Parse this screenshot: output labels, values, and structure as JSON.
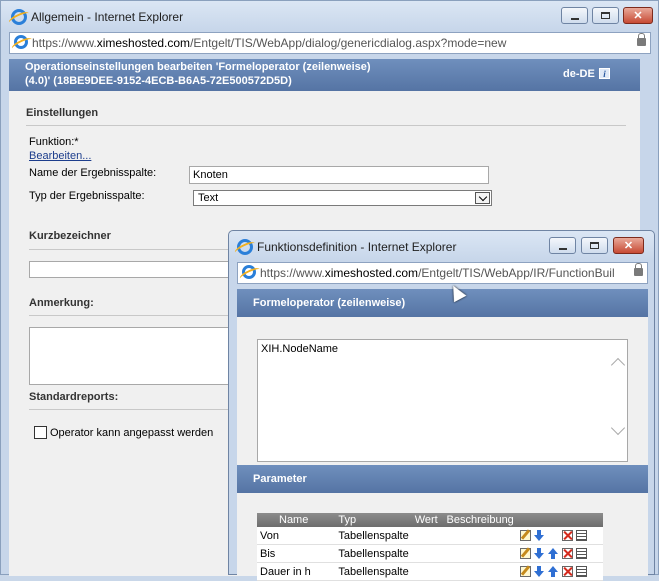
{
  "main_window": {
    "title": "Allgemein - Internet Explorer",
    "url_prefix": "https://www.",
    "url_domain": "ximeshosted.com",
    "url_rest": "/Entgelt/TIS/WebApp/dialog/genericdialog.aspx?mode=new",
    "header_line1": "Operationseinstellungen bearbeiten 'Formeloperator (zeilenweise)",
    "header_line2": "(4.0)' (18BE9DEE-9152-4ECB-B6A5-72E500572D5D)",
    "language": "de-DE",
    "sections": {
      "settings": "Einstellungen",
      "short_id": "Kurzbezeichner",
      "remark": "Anmerkung:",
      "std_reports": "Standardreports:"
    },
    "fields": {
      "function_label": "Funktion:*",
      "edit_link": "Bearbeiten...",
      "result_name_label": "Name der Ergebnisspalte:",
      "result_name_value": "Knoten",
      "result_type_label": "Typ der Ergebnisspalte:",
      "result_type_value": "Text",
      "customizable_label": "Operator kann angepasst werden"
    }
  },
  "dialog_window": {
    "title": "Funktionsdefinition - Internet Explorer",
    "url_prefix": "https://www.",
    "url_domain": "ximeshosted.com",
    "url_rest": "/Entgelt/TIS/WebApp/IR/FunctionBuil",
    "formula_header": "Formeloperator (zeilenweise)",
    "formula_text": "XIH.NodeName",
    "parameter_header": "Parameter",
    "table": {
      "columns": [
        "Name",
        "Typ",
        "Wert",
        "Beschreibung"
      ],
      "rows": [
        {
          "name": "Von",
          "type": "Tabellenspalte"
        },
        {
          "name": "Bis",
          "type": "Tabellenspalte"
        },
        {
          "name": "Dauer in h",
          "type": "Tabellenspalte"
        }
      ]
    }
  }
}
